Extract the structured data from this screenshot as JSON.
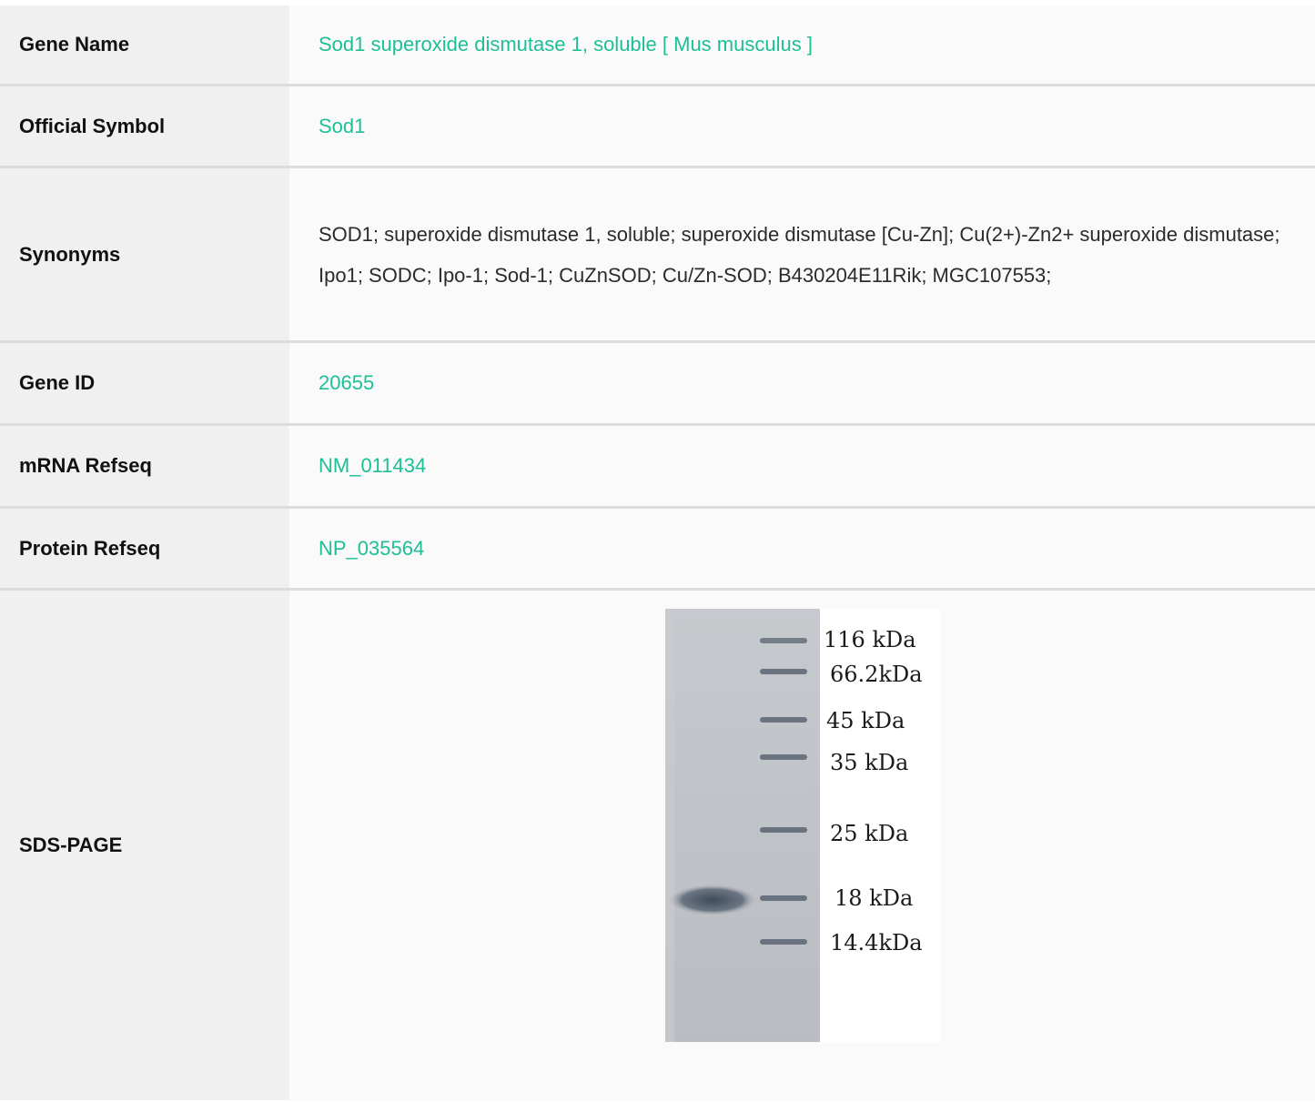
{
  "rows": {
    "gene_name": {
      "label": "Gene Name",
      "value": "Sod1 superoxide dismutase 1, soluble [ Mus musculus ]"
    },
    "official_symbol": {
      "label": "Official Symbol",
      "value": "Sod1"
    },
    "synonyms": {
      "label": "Synonyms",
      "value": "SOD1; superoxide dismutase 1, soluble; superoxide dismutase [Cu-Zn]; Cu(2+)-Zn2+ superoxide dismutase; Ipo1; SODC; Ipo-1; Sod-1; CuZnSOD; Cu/Zn-SOD; B430204E11Rik; MGC107553;"
    },
    "gene_id": {
      "label": "Gene ID",
      "value": "20655"
    },
    "mrna_refseq": {
      "label": "mRNA Refseq",
      "value": "NM_011434"
    },
    "protein_refseq": {
      "label": "Protein Refseq",
      "value": "NP_035564"
    },
    "sds_page": {
      "label": "SDS-PAGE"
    }
  },
  "gel": {
    "markers": [
      "116 kDa",
      "66.2kDa",
      "45 kDa",
      "35 kDa",
      "25 kDa",
      "18 kDa",
      "14.4kDa"
    ]
  },
  "colors": {
    "link": "#1dbf96",
    "label_bg": "#f0f0f0",
    "value_bg": "#fafafa",
    "divider": "#dcdcdc"
  }
}
